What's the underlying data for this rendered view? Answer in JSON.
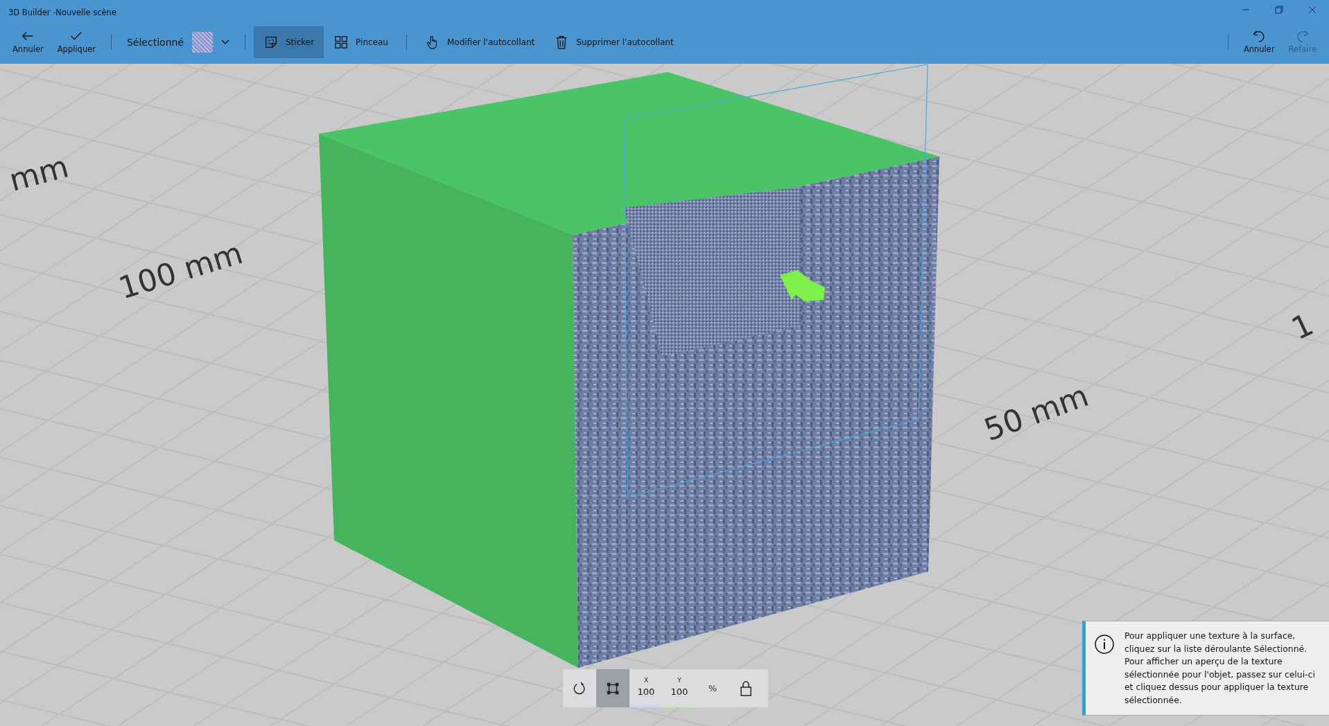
{
  "window": {
    "title": "3D Builder -Nouvelle scène"
  },
  "toolbar": {
    "left_buttons": [
      {
        "label": "Annuler",
        "kind": "back"
      },
      {
        "label": "Appliquer",
        "kind": "check"
      }
    ],
    "selection": {
      "label": "Sélectionné"
    },
    "modes": [
      {
        "label": "Sticker",
        "kind": "sticker",
        "selected": true
      },
      {
        "label": "Pinceau",
        "kind": "grid",
        "selected": false
      }
    ],
    "actions": [
      {
        "label": "Modifier l'autocollant",
        "kind": "hand"
      },
      {
        "label": "Supprimer l'autocollant",
        "kind": "trash"
      }
    ],
    "history": [
      {
        "label": "Annuler",
        "kind": "undo",
        "disabled": false
      },
      {
        "label": "Refaire",
        "kind": "redo",
        "disabled": true
      }
    ]
  },
  "viewport": {
    "grid_labels": [
      "mm",
      "100 mm",
      "50 mm",
      "1"
    ]
  },
  "transform_bar": {
    "tools": [
      {
        "kind": "rotate",
        "selected": false
      },
      {
        "kind": "scale",
        "selected": true
      }
    ],
    "fields": [
      {
        "label": "X",
        "value": "100",
        "color": "#c4dcef"
      },
      {
        "label": "Y",
        "value": "100",
        "color": "#c8ecc0"
      }
    ],
    "unit": "%"
  },
  "info": {
    "text": "Pour appliquer une texture à la surface, cliquez sur la liste déroulante Sélectionné. Pour afficher un aperçu de la texture sélectionnée pour l'objet, passez sur celui-ci et cliquez dessus pour appliquer la texture sélectionnée."
  }
}
